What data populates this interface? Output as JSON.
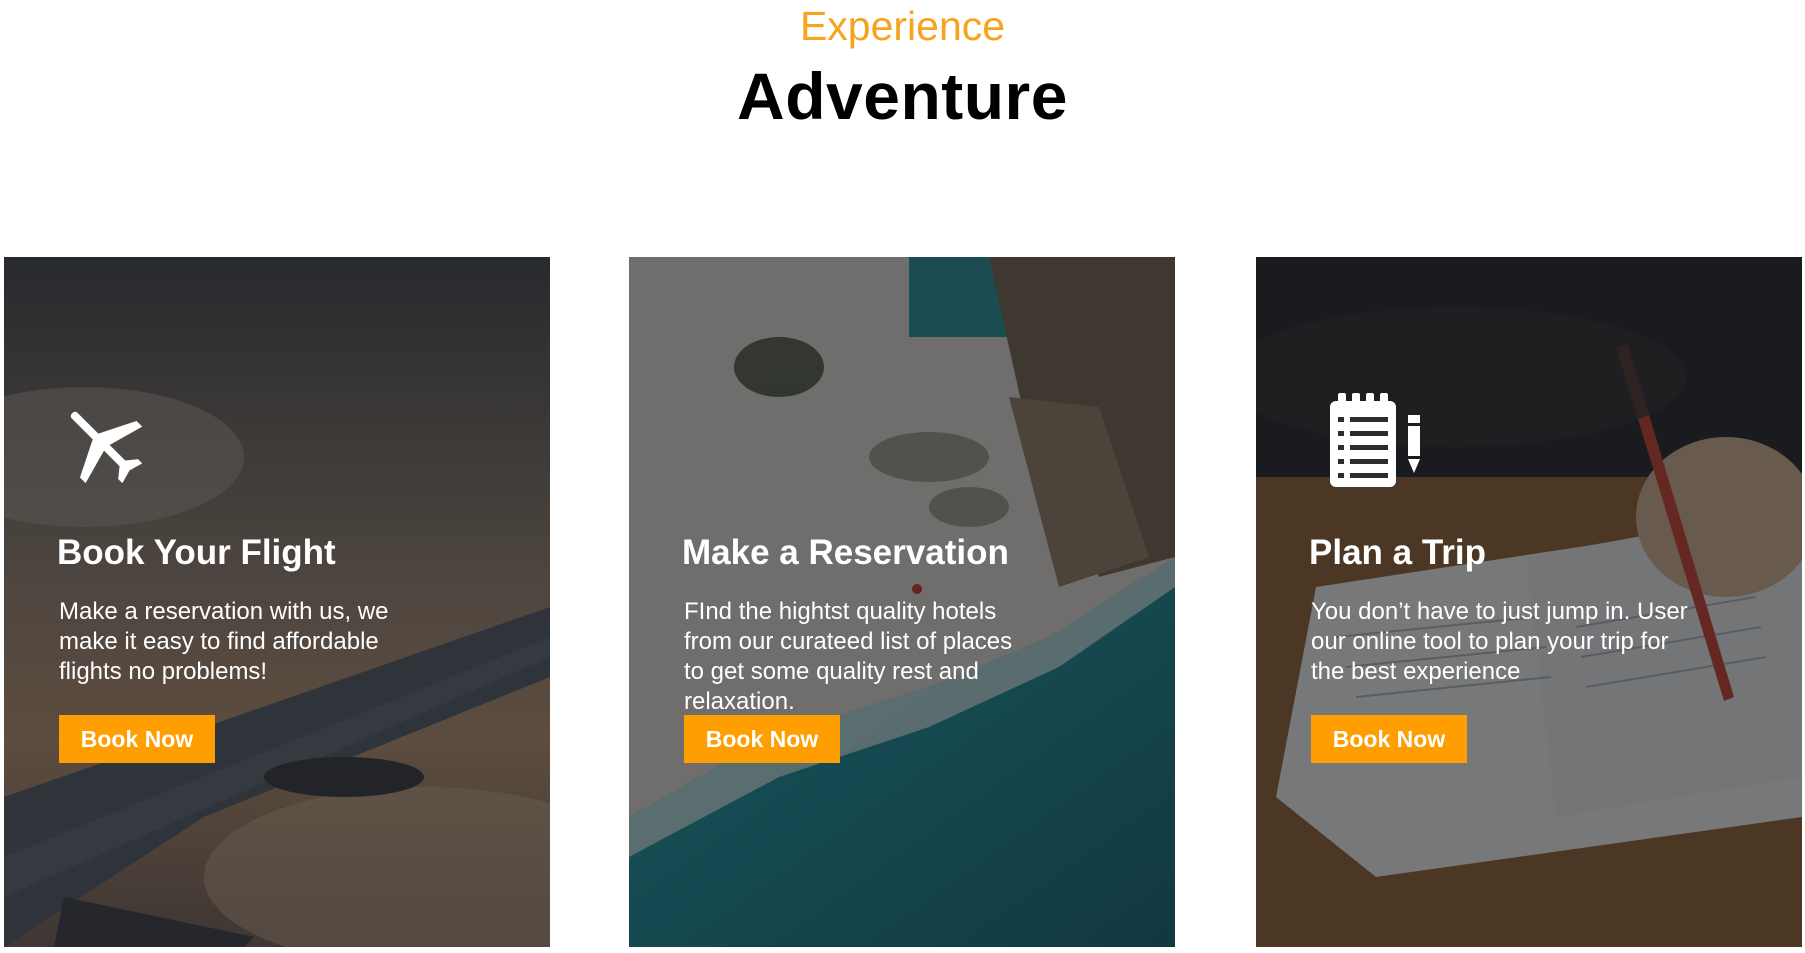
{
  "header": {
    "eyebrow": "Experience",
    "title": "Adventure"
  },
  "colors": {
    "accent": "#ff9e00",
    "eyebrow": "#f7a31c",
    "title": "#000000",
    "card_text": "#ffffff"
  },
  "cards": [
    {
      "icon": "airplane-icon",
      "title": "Book Your Flight",
      "description": "Make a reservation with us, we make it easy to find affordable flights no problems!",
      "button_label": "Book Now"
    },
    {
      "icon": "none",
      "title": "Make a Reservation",
      "description": "FInd the hightst quality hotels from our curateed list of places to get some quality rest and relaxation.",
      "button_label": "Book Now"
    },
    {
      "icon": "notepad-pencil-icon",
      "title": "Plan a Trip",
      "description": "You don’t have to just jump in. User our online tool to plan your trip for the best experience",
      "button_label": "Book Now"
    }
  ]
}
